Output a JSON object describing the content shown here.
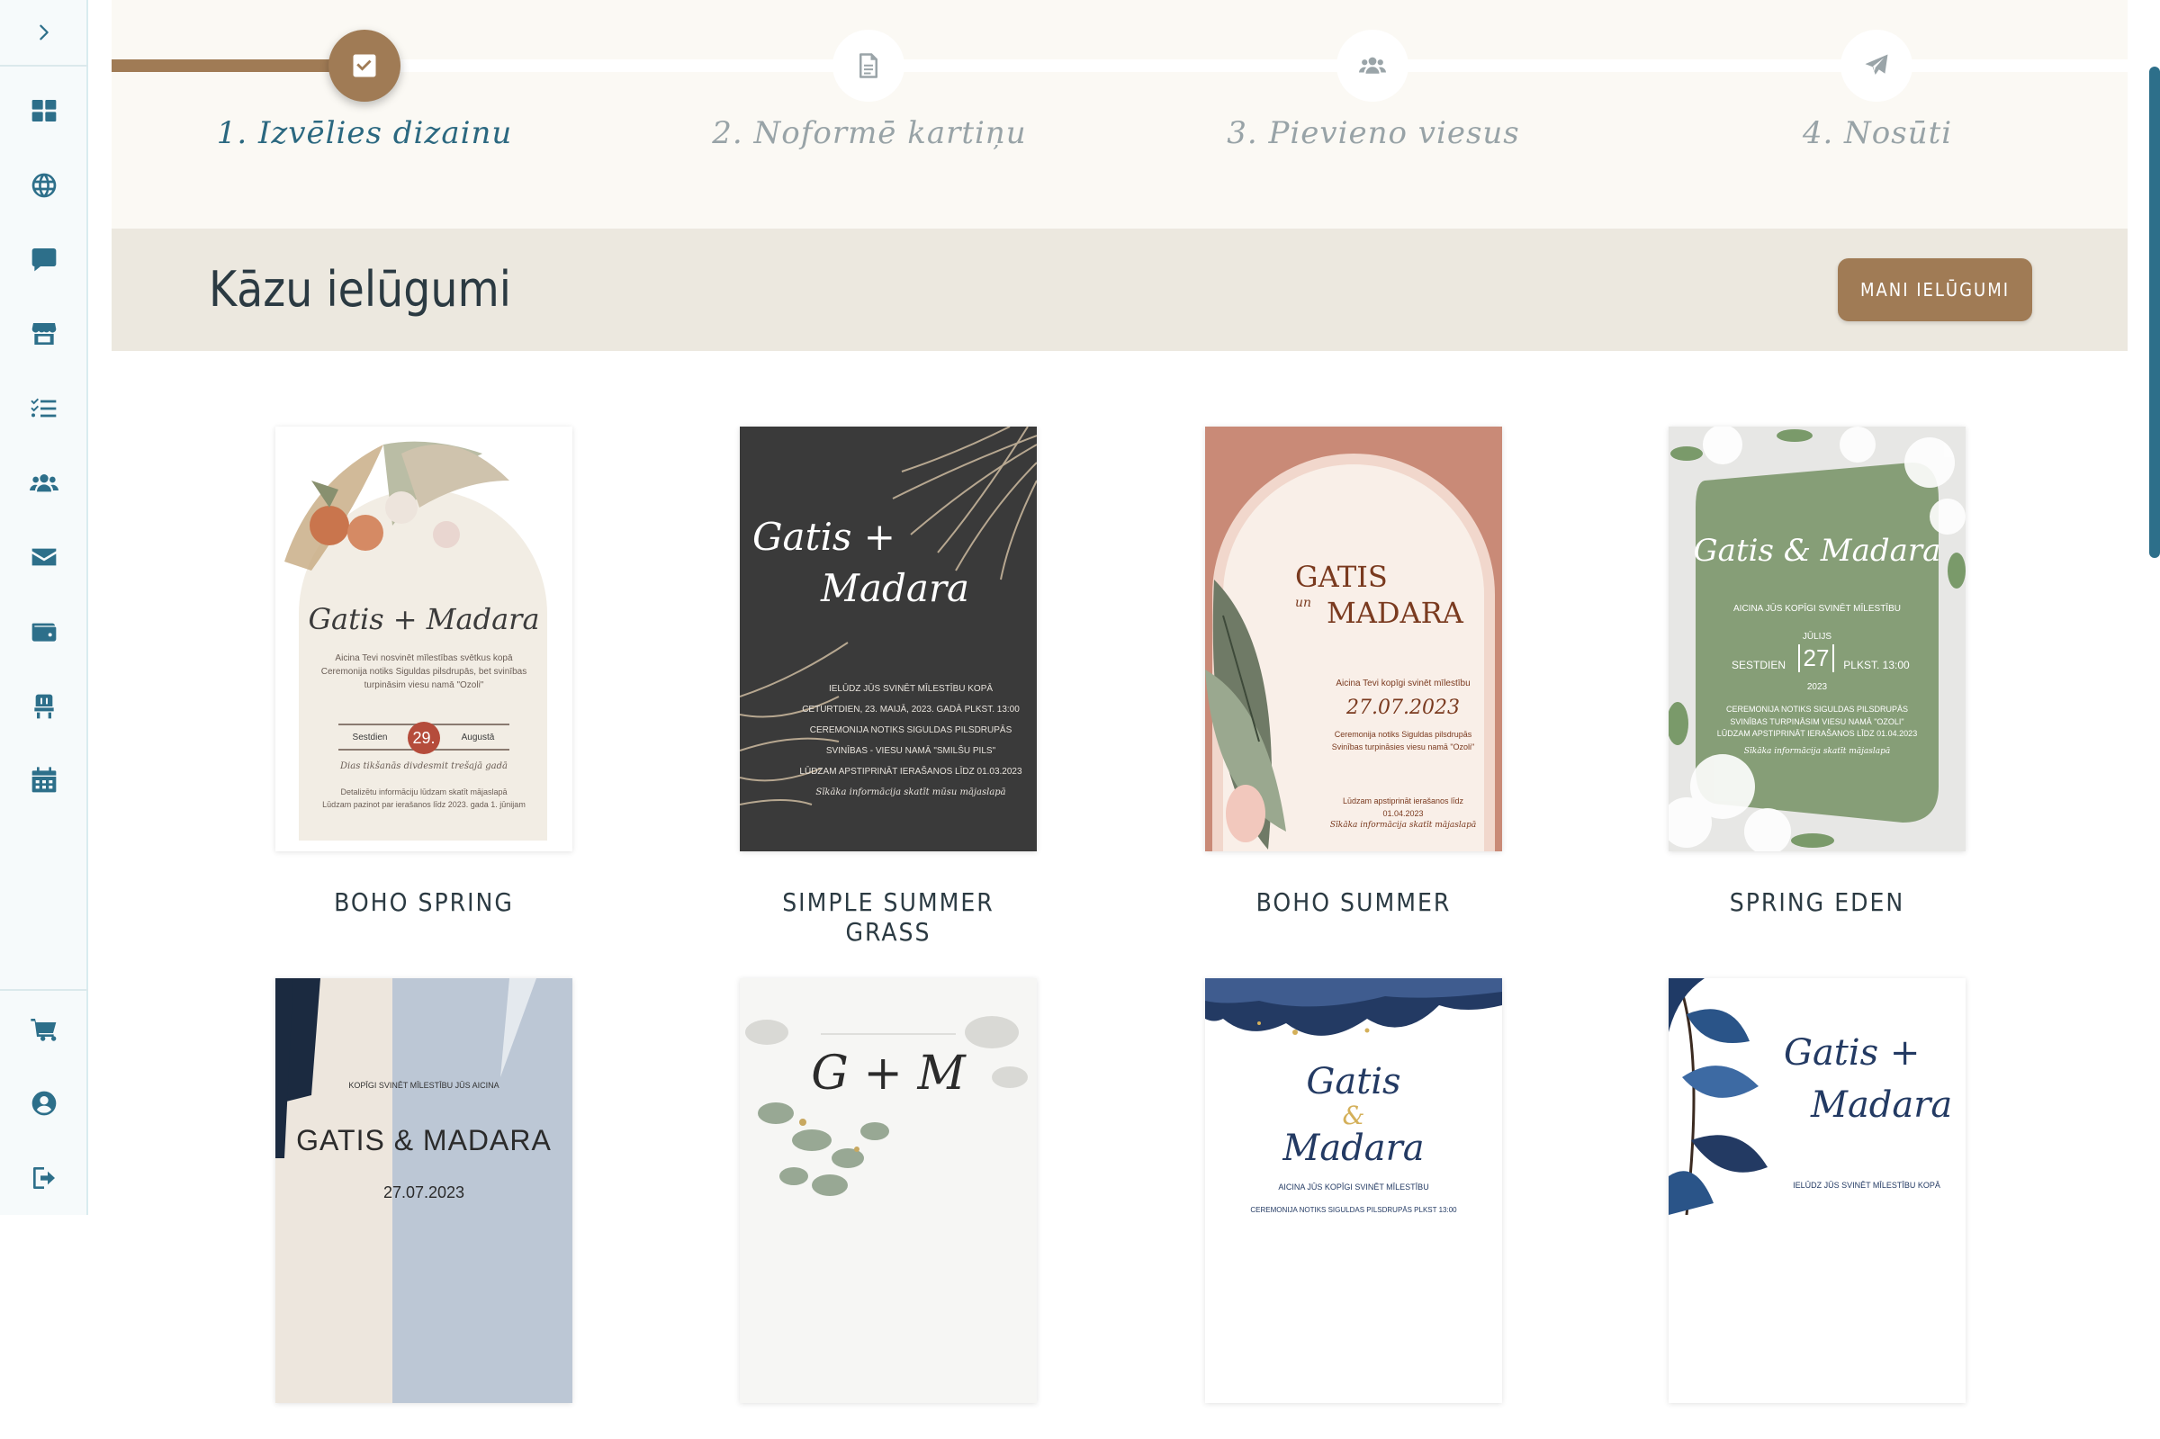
{
  "sidebar": {
    "items": [
      {
        "name": "dashboard",
        "icon": "dashboard-icon"
      },
      {
        "name": "website",
        "icon": "globe-icon"
      },
      {
        "name": "messages",
        "icon": "chat-icon"
      },
      {
        "name": "vendors",
        "icon": "store-icon"
      },
      {
        "name": "checklist",
        "icon": "checklist-icon"
      },
      {
        "name": "guests",
        "icon": "users-icon"
      },
      {
        "name": "invitations",
        "icon": "envelope-icon"
      },
      {
        "name": "budget",
        "icon": "wallet-icon"
      },
      {
        "name": "seating",
        "icon": "chair-icon"
      },
      {
        "name": "calendar",
        "icon": "calendar-icon"
      }
    ],
    "bottom_items": [
      {
        "name": "cart",
        "icon": "cart-icon"
      },
      {
        "name": "profile",
        "icon": "user-circle-icon"
      },
      {
        "name": "logout",
        "icon": "logout-icon"
      }
    ]
  },
  "stepper": {
    "steps": [
      {
        "label": "1. Izvēlies dizainu",
        "icon": "check-icon",
        "active": true
      },
      {
        "label": "2. Noformē kartiņu",
        "icon": "document-icon",
        "active": false
      },
      {
        "label": "3. Pievieno viesus",
        "icon": "users-icon",
        "active": false
      },
      {
        "label": "4. Nosūti",
        "icon": "paper-plane-icon",
        "active": false
      }
    ]
  },
  "header": {
    "title": "Kāzu ielūgumi",
    "my_invites_button": "MANI IELŪGUMI"
  },
  "cards": [
    {
      "name": "BOHO SPRING",
      "thumb": {
        "names": "Gatis + Madara",
        "text1": "Aicina Tevi nosvinēt mīlestības svētkus kopā",
        "text2": "Ceremonija notiks Siguldas pilsdrupās, bet svinības",
        "text3": "turpināsim viesu namā \"Ozoli\"",
        "day": "Sestdien",
        "date": "29.",
        "month": "Augustā",
        "script_line": "Dias tikšanās divdesmit trešajā gadā",
        "footer1": "Detalizētu informāciju lūdzam skatīt mājaslapā",
        "footer2": "Lūdzam pazinot par ierašanos līdz 2023. gada 1. jūnijam"
      }
    },
    {
      "name": "SIMPLE SUMMER GRASS",
      "thumb": {
        "names1": "Gatis +",
        "names2": "Madara",
        "line1": "IELŪDZ JŪS SVINĒT MĪLESTĪBU KOPĀ",
        "line2": "CETURTDIEN, 23. MAIJĀ, 2023. GADĀ PLKST. 13:00",
        "line3": "CEREMONIJA NOTIKS SIGULDAS PILSDRUPĀS",
        "line4": "SVINĪBAS - VIESU NAMĀ \"SMILŠU PILS\"",
        "line5": "LŪDZAM APSTIPRINĀT IERAŠANOS LĪDZ 01.03.2023",
        "line6": "Sīkāka informācija skatīt mūsu mājaslapā"
      }
    },
    {
      "name": "BOHO SUMMER",
      "thumb": {
        "name1": "GATIS",
        "and": "un",
        "name2": "MADARA",
        "line1": "Aicina Tevi kopīgi svinēt mīlestību",
        "date": "27.07.2023",
        "line2": "Ceremonija notiks Siguldas pilsdrupās",
        "line3": "Svinības turpināsies viesu namā \"Ozoli\"",
        "line4": "Lūdzam apstiprināt ierašanos līdz 01.04.2023",
        "line5": "Sīkāka informācija skatīt mājaslapā"
      }
    },
    {
      "name": "SPRING EDEN",
      "thumb": {
        "names": "Gatis & Madara",
        "line1": "AICINA JŪS KOPĪGI SVINĒT MĪLESTĪBU",
        "month": "JŪLIJS",
        "day": "SESTDIEN",
        "date": "27",
        "time": "PLKST. 13:00",
        "year": "2023",
        "line2": "CEREMONIJA NOTIKS SIGULDAS PILSDRUPĀS",
        "line3": "SVINĪBAS TURPINĀSIM VIESU NAMĀ \"OZOLI\"",
        "line4": "LŪDZAM APSTIPRINĀT IERAŠANOS LĪDZ 01.04.2023",
        "line5": "Sīkāka informācija skatīt mājaslapā"
      }
    },
    {
      "name": "",
      "thumb": {
        "line1": "KOPĪGI SVINĒT MĪLESTĪBU JŪS AICINA",
        "names": "GATIS & MADARA",
        "date": "27.07.2023"
      }
    },
    {
      "name": "",
      "thumb": {
        "monogram": "G + M"
      }
    },
    {
      "name": "",
      "thumb": {
        "name1": "Gatis",
        "and": "&",
        "name2": "Madara",
        "line1": "AICINA JŪS KOPĪGI SVINĒT MĪLESTĪBU",
        "line2": "CEREMONIJA NOTIKS SIGULDAS PILSDRUPĀS PLKST 13:00"
      }
    },
    {
      "name": "",
      "thumb": {
        "names1": "Gatis +",
        "names2": "Madara",
        "line1": "IELŪDZ JŪS SVINĒT MĪLESTĪBU KOPĀ"
      }
    }
  ],
  "colors": {
    "accent": "#a07b55",
    "primary": "#2d6f8a",
    "sidebar_bg": "#f6fafb",
    "stepper_bg": "#fbf9f4",
    "header_bg": "#ece8df"
  }
}
